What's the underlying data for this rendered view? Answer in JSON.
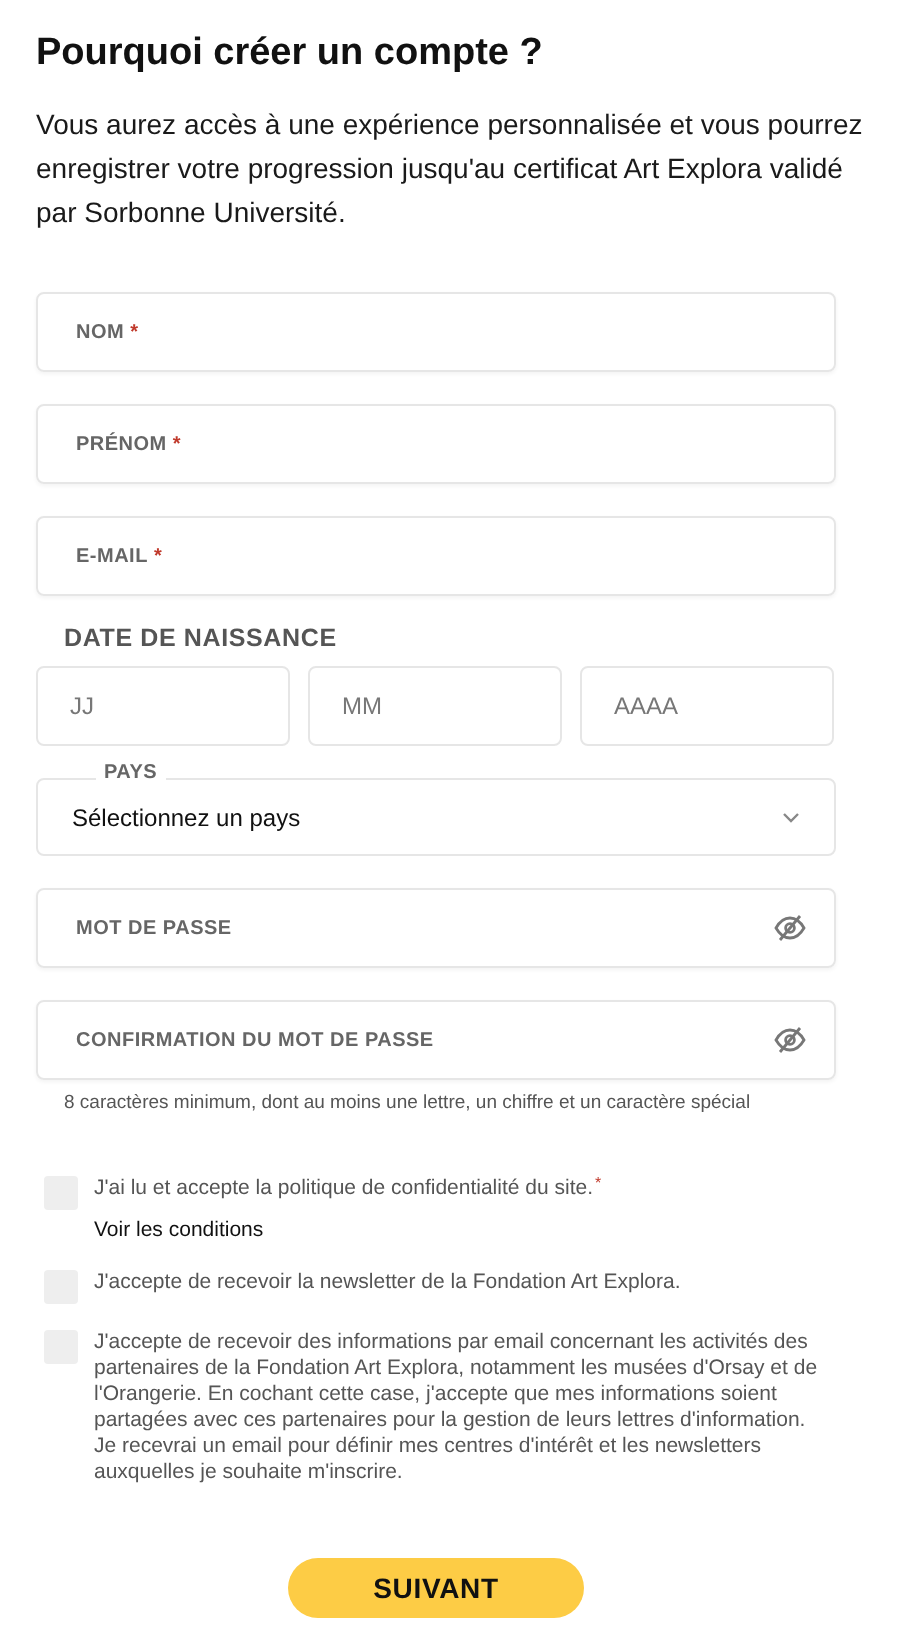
{
  "heading": "Pourquoi créer un compte ?",
  "intro": "Vous aurez accès à une expérience personnalisée et vous pourrez enregistrer votre progression jusqu'au certificat Art Explora validé par Sorbonne Université.",
  "fields_top": [
    {
      "label": "NOM",
      "required_mark": "*"
    },
    {
      "label": "PRÉNOM",
      "required_mark": "*"
    },
    {
      "label": "E-MAIL",
      "required_mark": "*"
    }
  ],
  "birth_date": {
    "label": "DATE DE NAISSANCE",
    "parts": [
      {
        "placeholder": "JJ"
      },
      {
        "placeholder": "MM"
      },
      {
        "placeholder": "AAAA"
      }
    ]
  },
  "country": {
    "label": "PAYS",
    "value": "Sélectionnez un pays"
  },
  "password_fields": [
    {
      "label": "MOT DE PASSE"
    },
    {
      "label": "CONFIRMATION DU MOT DE PASSE"
    }
  ],
  "password_hint": "8 caractères minimum, dont au moins une lettre, un chiffre et un caractère spécial",
  "consents": [
    {
      "text": "J'ai lu et accepte la politique de confidentialité du site.",
      "required_mark": "*",
      "checked": false,
      "link": "Voir les conditions"
    },
    {
      "text": "J'accepte de recevoir la newsletter de la Fondation Art Explora.",
      "checked": false
    },
    {
      "text": "J'accepte de recevoir des informations par email concernant les activités des partenaires de la Fondation Art Explora, notamment les musées d'Orsay et de l'Orangerie. En cochant cette case, j'accepte que mes informations soient partagées avec ces partenaires pour la gestion de leurs lettres d'information. Je recevrai un email pour définir mes centres d'intérêt et les newsletters auxquelles je souhaite m'inscrire.",
      "checked": false
    }
  ],
  "submit": "SUIVANT"
}
